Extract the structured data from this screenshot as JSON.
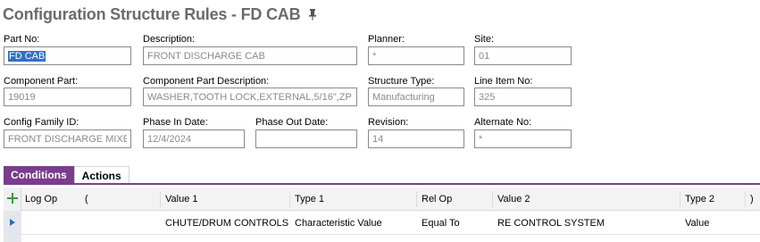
{
  "page": {
    "title": "Configuration Structure Rules - FD CAB",
    "pin_icon": "pin-icon"
  },
  "fields": {
    "part_no": {
      "label": "Part No:",
      "value": "FD CAB"
    },
    "description": {
      "label": "Description:",
      "value": "FRONT DISCHARGE CAB"
    },
    "planner": {
      "label": "Planner:",
      "value": "*"
    },
    "site": {
      "label": "Site:",
      "value": "01"
    },
    "component_part": {
      "label": "Component Part:",
      "value": "19019"
    },
    "component_part_description": {
      "label": "Component Part Description:",
      "value": "WASHER,TOOTH LOCK,EXTERNAL,5/16\",ZP"
    },
    "structure_type": {
      "label": "Structure Type:",
      "value": "Manufacturing"
    },
    "line_item_no": {
      "label": "Line Item No:",
      "value": "325"
    },
    "config_family_id": {
      "label": "Config Family ID:",
      "value": "FRONT DISCHARGE MIXER"
    },
    "phase_in_date": {
      "label": "Phase In Date:",
      "value": "12/4/2024"
    },
    "phase_out_date": {
      "label": "Phase Out Date:",
      "value": ""
    },
    "revision": {
      "label": "Revision:",
      "value": "14"
    },
    "alternate_no": {
      "label": "Alternate No:",
      "value": "*"
    }
  },
  "tabs": [
    {
      "label": "Conditions",
      "active": true
    },
    {
      "label": "Actions",
      "active": false
    }
  ],
  "grid": {
    "add_icon": "add-icon",
    "columns": [
      "Log Op",
      "(",
      "Value 1",
      "Type 1",
      "Rel Op",
      "Value 2",
      "Type 2",
      ")"
    ],
    "rows": [
      {
        "log_op": "",
        "open_paren": "",
        "value1": "CHUTE/DRUM CONTROLS",
        "type1": "Characteristic Value",
        "rel_op": "Equal To",
        "value2": "RE CONTROL SYSTEM",
        "type2": "Value",
        "close_paren": ""
      }
    ]
  },
  "colors": {
    "accent": "#7a3d8c",
    "selection": "#3470c5",
    "title_gray": "#6b6b6b"
  }
}
